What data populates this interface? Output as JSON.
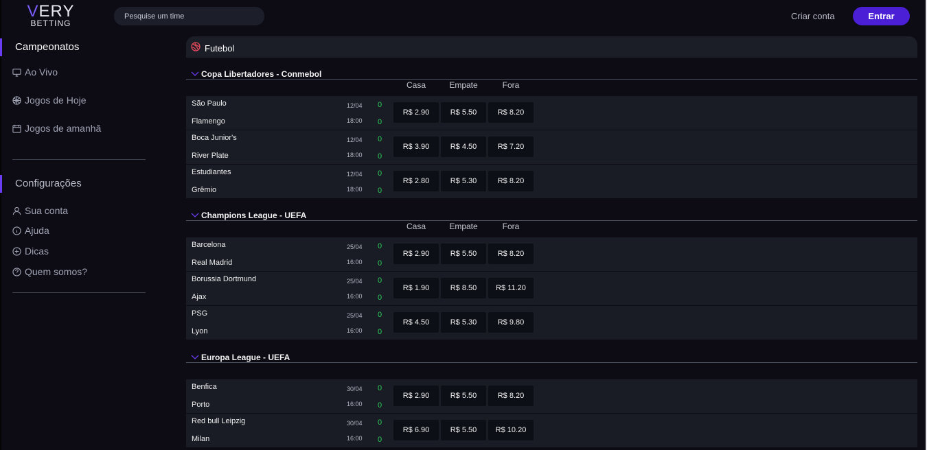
{
  "header": {
    "logo_line1_v": "V",
    "logo_line1_rest": "ERY",
    "logo_line2": "BETTING",
    "search_placeholder": "Pesquise um time",
    "criar_conta": "Criar conta",
    "entrar": "Entrar"
  },
  "sidebar": {
    "section1": "Campeonatos",
    "items1": [
      {
        "label": "Ao Vivo",
        "icon": "monitor-icon"
      },
      {
        "label": "Jogos de Hoje",
        "icon": "ball-icon"
      },
      {
        "label": "Jogos de amanhã",
        "icon": "calendar-icon"
      }
    ],
    "section2": "Configurações",
    "items2": [
      {
        "label": "Sua conta",
        "icon": "user-icon"
      },
      {
        "label": "Ajuda",
        "icon": "info-icon"
      },
      {
        "label": "Dicas",
        "icon": "plus-circle-icon"
      },
      {
        "label": "Quem somos?",
        "icon": "question-icon"
      }
    ]
  },
  "main": {
    "sport_title": "Futebol",
    "columns": [
      "Casa",
      "Empate",
      "Fora"
    ],
    "leagues": [
      {
        "name": "Copa Libertadores - Conmebol",
        "show_columns": true,
        "matches": [
          {
            "home": "São Paulo",
            "away": "Flamengo",
            "date": "12/04",
            "time": "18:00",
            "score_home": "0",
            "score_away": "0",
            "odds": [
              "R$ 2.90",
              "R$ 5.50",
              "R$ 8.20"
            ]
          },
          {
            "home": "Boca Junior's",
            "away": "River Plate",
            "date": "12/04",
            "time": "18:00",
            "score_home": "0",
            "score_away": "0",
            "odds": [
              "R$ 3.90",
              "R$ 4.50",
              "R$ 7.20"
            ]
          },
          {
            "home": "Estudiantes",
            "away": "Grêmio",
            "date": "12/04",
            "time": "18:00",
            "score_home": "0",
            "score_away": "0",
            "odds": [
              "R$ 2.80",
              "R$ 5.30",
              "R$ 8.20"
            ]
          }
        ]
      },
      {
        "name": "Champions League - UEFA",
        "show_columns": true,
        "matches": [
          {
            "home": "Barcelona",
            "away": "Real Madrid",
            "date": "25/04",
            "time": "16:00",
            "score_home": "0",
            "score_away": "0",
            "odds": [
              "R$ 2.90",
              "R$ 5.50",
              "R$ 8.20"
            ]
          },
          {
            "home": "Borussia Dortmund",
            "away": "Ajax",
            "date": "25/04",
            "time": "16:00",
            "score_home": "0",
            "score_away": "0",
            "odds": [
              "R$ 1.90",
              "R$ 8.50",
              "R$ 11.20"
            ]
          },
          {
            "home": "PSG",
            "away": "Lyon",
            "date": "25/04",
            "time": "16:00",
            "score_home": "0",
            "score_away": "0",
            "odds": [
              "R$ 4.50",
              "R$ 5.30",
              "R$ 9.80"
            ]
          }
        ]
      },
      {
        "name": "Europa League - UEFA",
        "show_columns": false,
        "matches": [
          {
            "home": "Benfica",
            "away": "Porto",
            "date": "30/04",
            "time": "16:00",
            "score_home": "0",
            "score_away": "0",
            "odds": [
              "R$ 2.90",
              "R$ 5.50",
              "R$ 8.20"
            ]
          },
          {
            "home": "Red bull Leipzig",
            "away": "Milan",
            "date": "30/04",
            "time": "16:00",
            "score_home": "0",
            "score_away": "0",
            "odds": [
              "R$ 6.90",
              "R$ 5.50",
              "R$ 10.20"
            ]
          }
        ]
      }
    ]
  },
  "colors": {
    "accent": "#4b1fd6",
    "sidebar_marker": "#6a3df2",
    "score_green": "#2ecf5a",
    "row_bg": "#191c25",
    "page_bg": "#0d0b14"
  }
}
